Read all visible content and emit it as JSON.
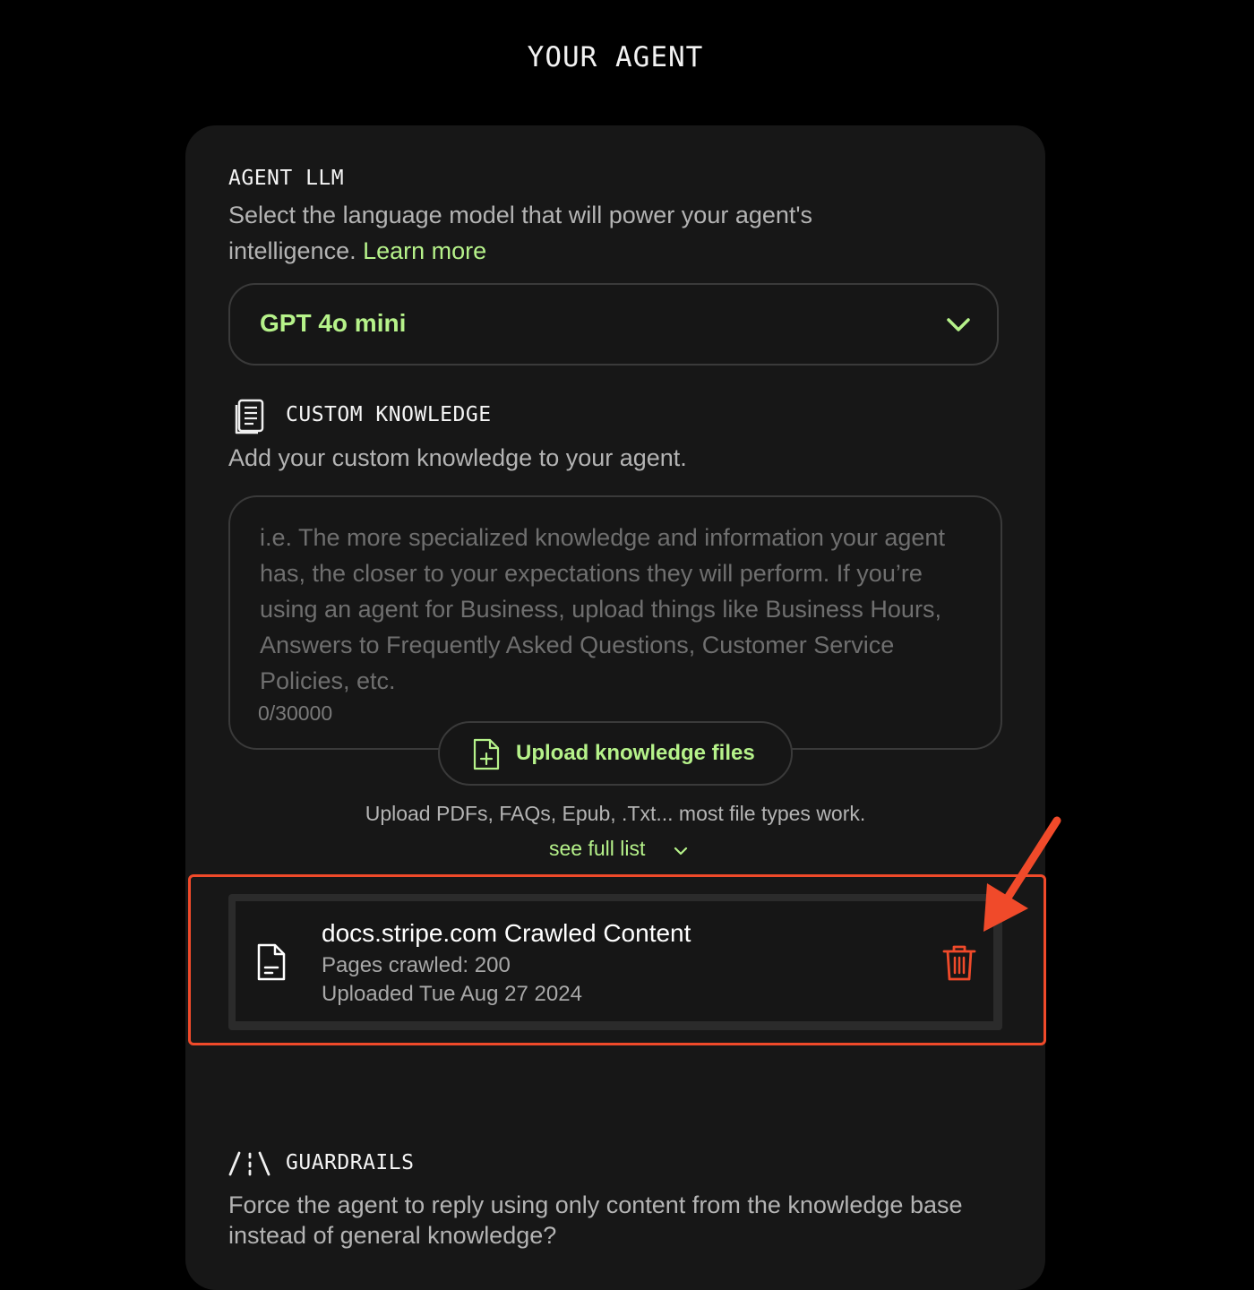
{
  "page": {
    "title": "YOUR AGENT"
  },
  "agent_llm": {
    "heading": "AGENT LLM",
    "description": "Select the language model that will power your agent's",
    "description_line2": "intelligence.",
    "learn_more": "Learn more",
    "selected_model": "GPT 4o mini"
  },
  "custom_knowledge": {
    "heading": "CUSTOM KNOWLEDGE",
    "description": "Add your custom knowledge to your agent.",
    "placeholder": "i.e. The more specialized knowledge and information your agent has, the closer to your expectations they will perform. If you’re using an agent for Business, upload things like Business Hours, Answers to Frequently Asked Questions, Customer Service Policies, etc.",
    "char_counter": "0/30000",
    "upload_button": "Upload knowledge files",
    "upload_hint": "Upload PDFs, FAQs, Epub, .Txt... most file types work.",
    "see_full_list": "see full list"
  },
  "uploaded_file": {
    "name": "docs.stripe.com Crawled Content",
    "pages_crawled": "Pages crawled: 200",
    "uploaded": "Uploaded Tue Aug 27 2024"
  },
  "guardrails": {
    "heading": "GUARDRAILS",
    "description": "Force the agent to reply using only content from the knowledge base instead of general knowledge?"
  },
  "colors": {
    "accent_green": "#b6f28a",
    "danger_red": "#f04a2a",
    "card_bg": "#171717"
  },
  "icons": {
    "dropdown": "chevron-down-icon",
    "knowledge": "document-list-icon",
    "upload": "file-plus-icon",
    "file": "file-icon",
    "delete": "trash-icon",
    "guardrails": "guardrails-icon"
  }
}
